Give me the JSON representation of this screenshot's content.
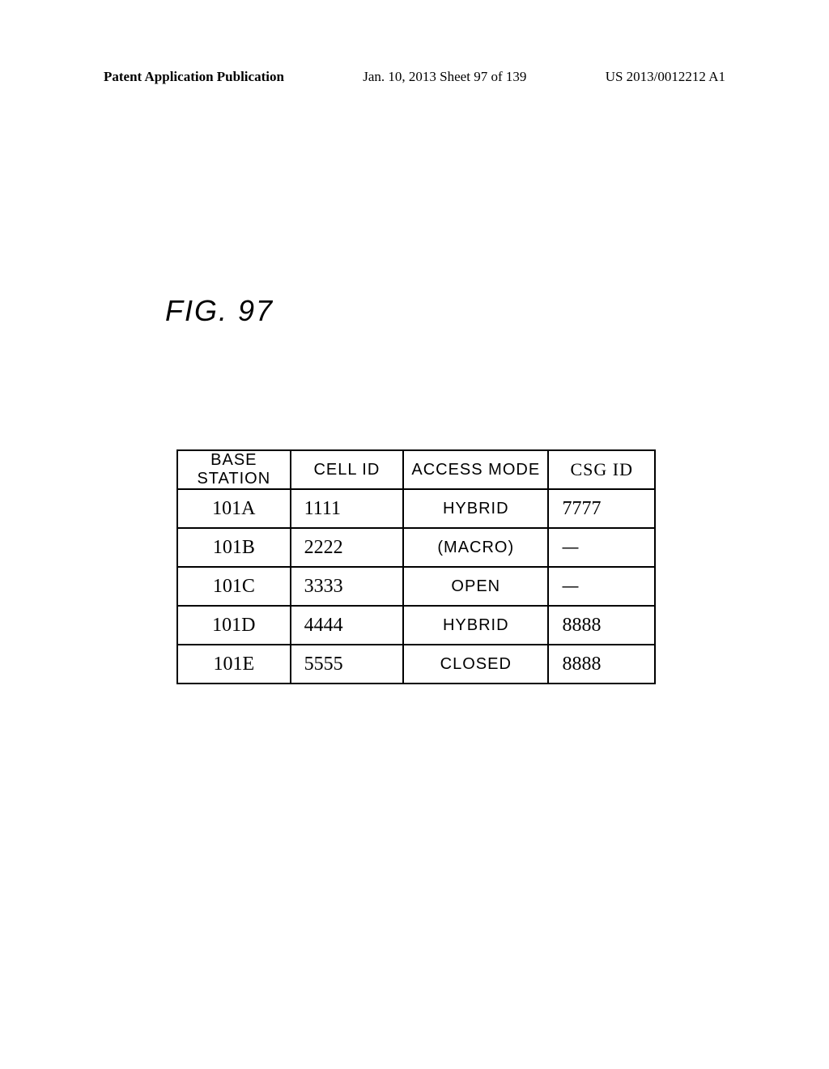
{
  "header": {
    "left": "Patent Application Publication",
    "center": "Jan. 10, 2013  Sheet 97 of 139",
    "right": "US 2013/0012212 A1"
  },
  "figure_label": "FIG. 97",
  "table": {
    "headers": {
      "base_station": "BASE STATION",
      "cell_id": "CELL ID",
      "access_mode": "ACCESS MODE",
      "csg_id": "CSG ID"
    },
    "rows": [
      {
        "base_station": "101A",
        "cell_id": "1111",
        "access_mode": "HYBRID",
        "csg_id": "7777"
      },
      {
        "base_station": "101B",
        "cell_id": "2222",
        "access_mode": "(MACRO)",
        "csg_id": "—"
      },
      {
        "base_station": "101C",
        "cell_id": "3333",
        "access_mode": "OPEN",
        "csg_id": "—"
      },
      {
        "base_station": "101D",
        "cell_id": "4444",
        "access_mode": "HYBRID",
        "csg_id": "8888"
      },
      {
        "base_station": "101E",
        "cell_id": "5555",
        "access_mode": "CLOSED",
        "csg_id": "8888"
      }
    ]
  }
}
